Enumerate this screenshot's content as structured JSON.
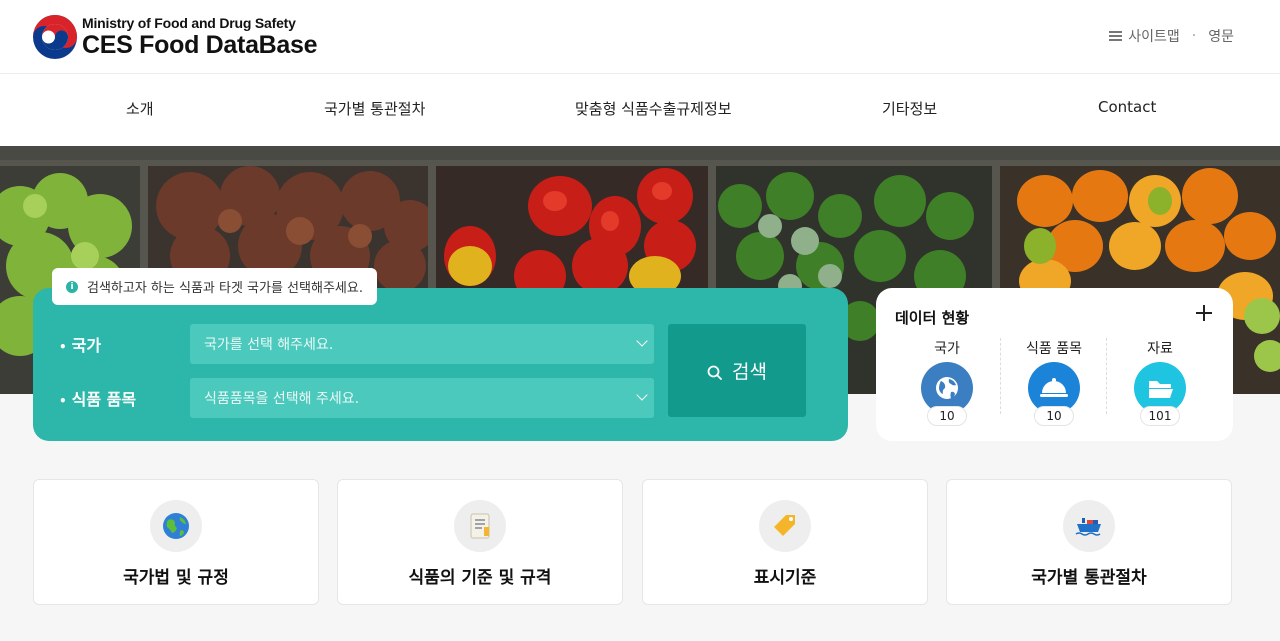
{
  "header": {
    "org_name": "Ministry of Food and Drug Safety",
    "site_name": "CES Food DataBase",
    "util_links": {
      "sitemap": "사이트맵",
      "separator": "·",
      "english": "영문"
    }
  },
  "gnb": {
    "items": [
      {
        "label": "소개"
      },
      {
        "label": "국가별 통관절차"
      },
      {
        "label": "맞춤형 식품수출규제정보"
      },
      {
        "label": "기타정보"
      },
      {
        "label": "Contact"
      }
    ]
  },
  "search": {
    "notice": "검색하고자 하는 식품과 타겟 국가를 선택해주세요.",
    "country_label": "국가",
    "country_placeholder": "국가를 선택 해주세요.",
    "item_label": "식품 품목",
    "item_placeholder": "식품품목을 선택해 주세요.",
    "button_label": "검색",
    "bullet": "•"
  },
  "stats": {
    "title": "데이터 현황",
    "items": [
      {
        "label": "국가",
        "count": "10",
        "icon": "globe-icon",
        "color": "#3b7ec2"
      },
      {
        "label": "식품 품목",
        "count": "10",
        "icon": "cloche-icon",
        "color": "#1b84d8"
      },
      {
        "label": "자료",
        "count": "101",
        "icon": "folder-icon",
        "color": "#1fc4e0"
      }
    ]
  },
  "cards": [
    {
      "title": "국가법 및 규정",
      "icon": "earth-globe-icon"
    },
    {
      "title": "식품의 기준 및 규격",
      "icon": "document-icon"
    },
    {
      "title": "표시기준",
      "icon": "label-tag-icon"
    },
    {
      "title": "국가별 통관절차",
      "icon": "cargo-ship-icon"
    }
  ],
  "colors": {
    "accent": "#2db7aa",
    "accent_dark": "#129a8d",
    "select_bg": "#4cc9bd"
  }
}
